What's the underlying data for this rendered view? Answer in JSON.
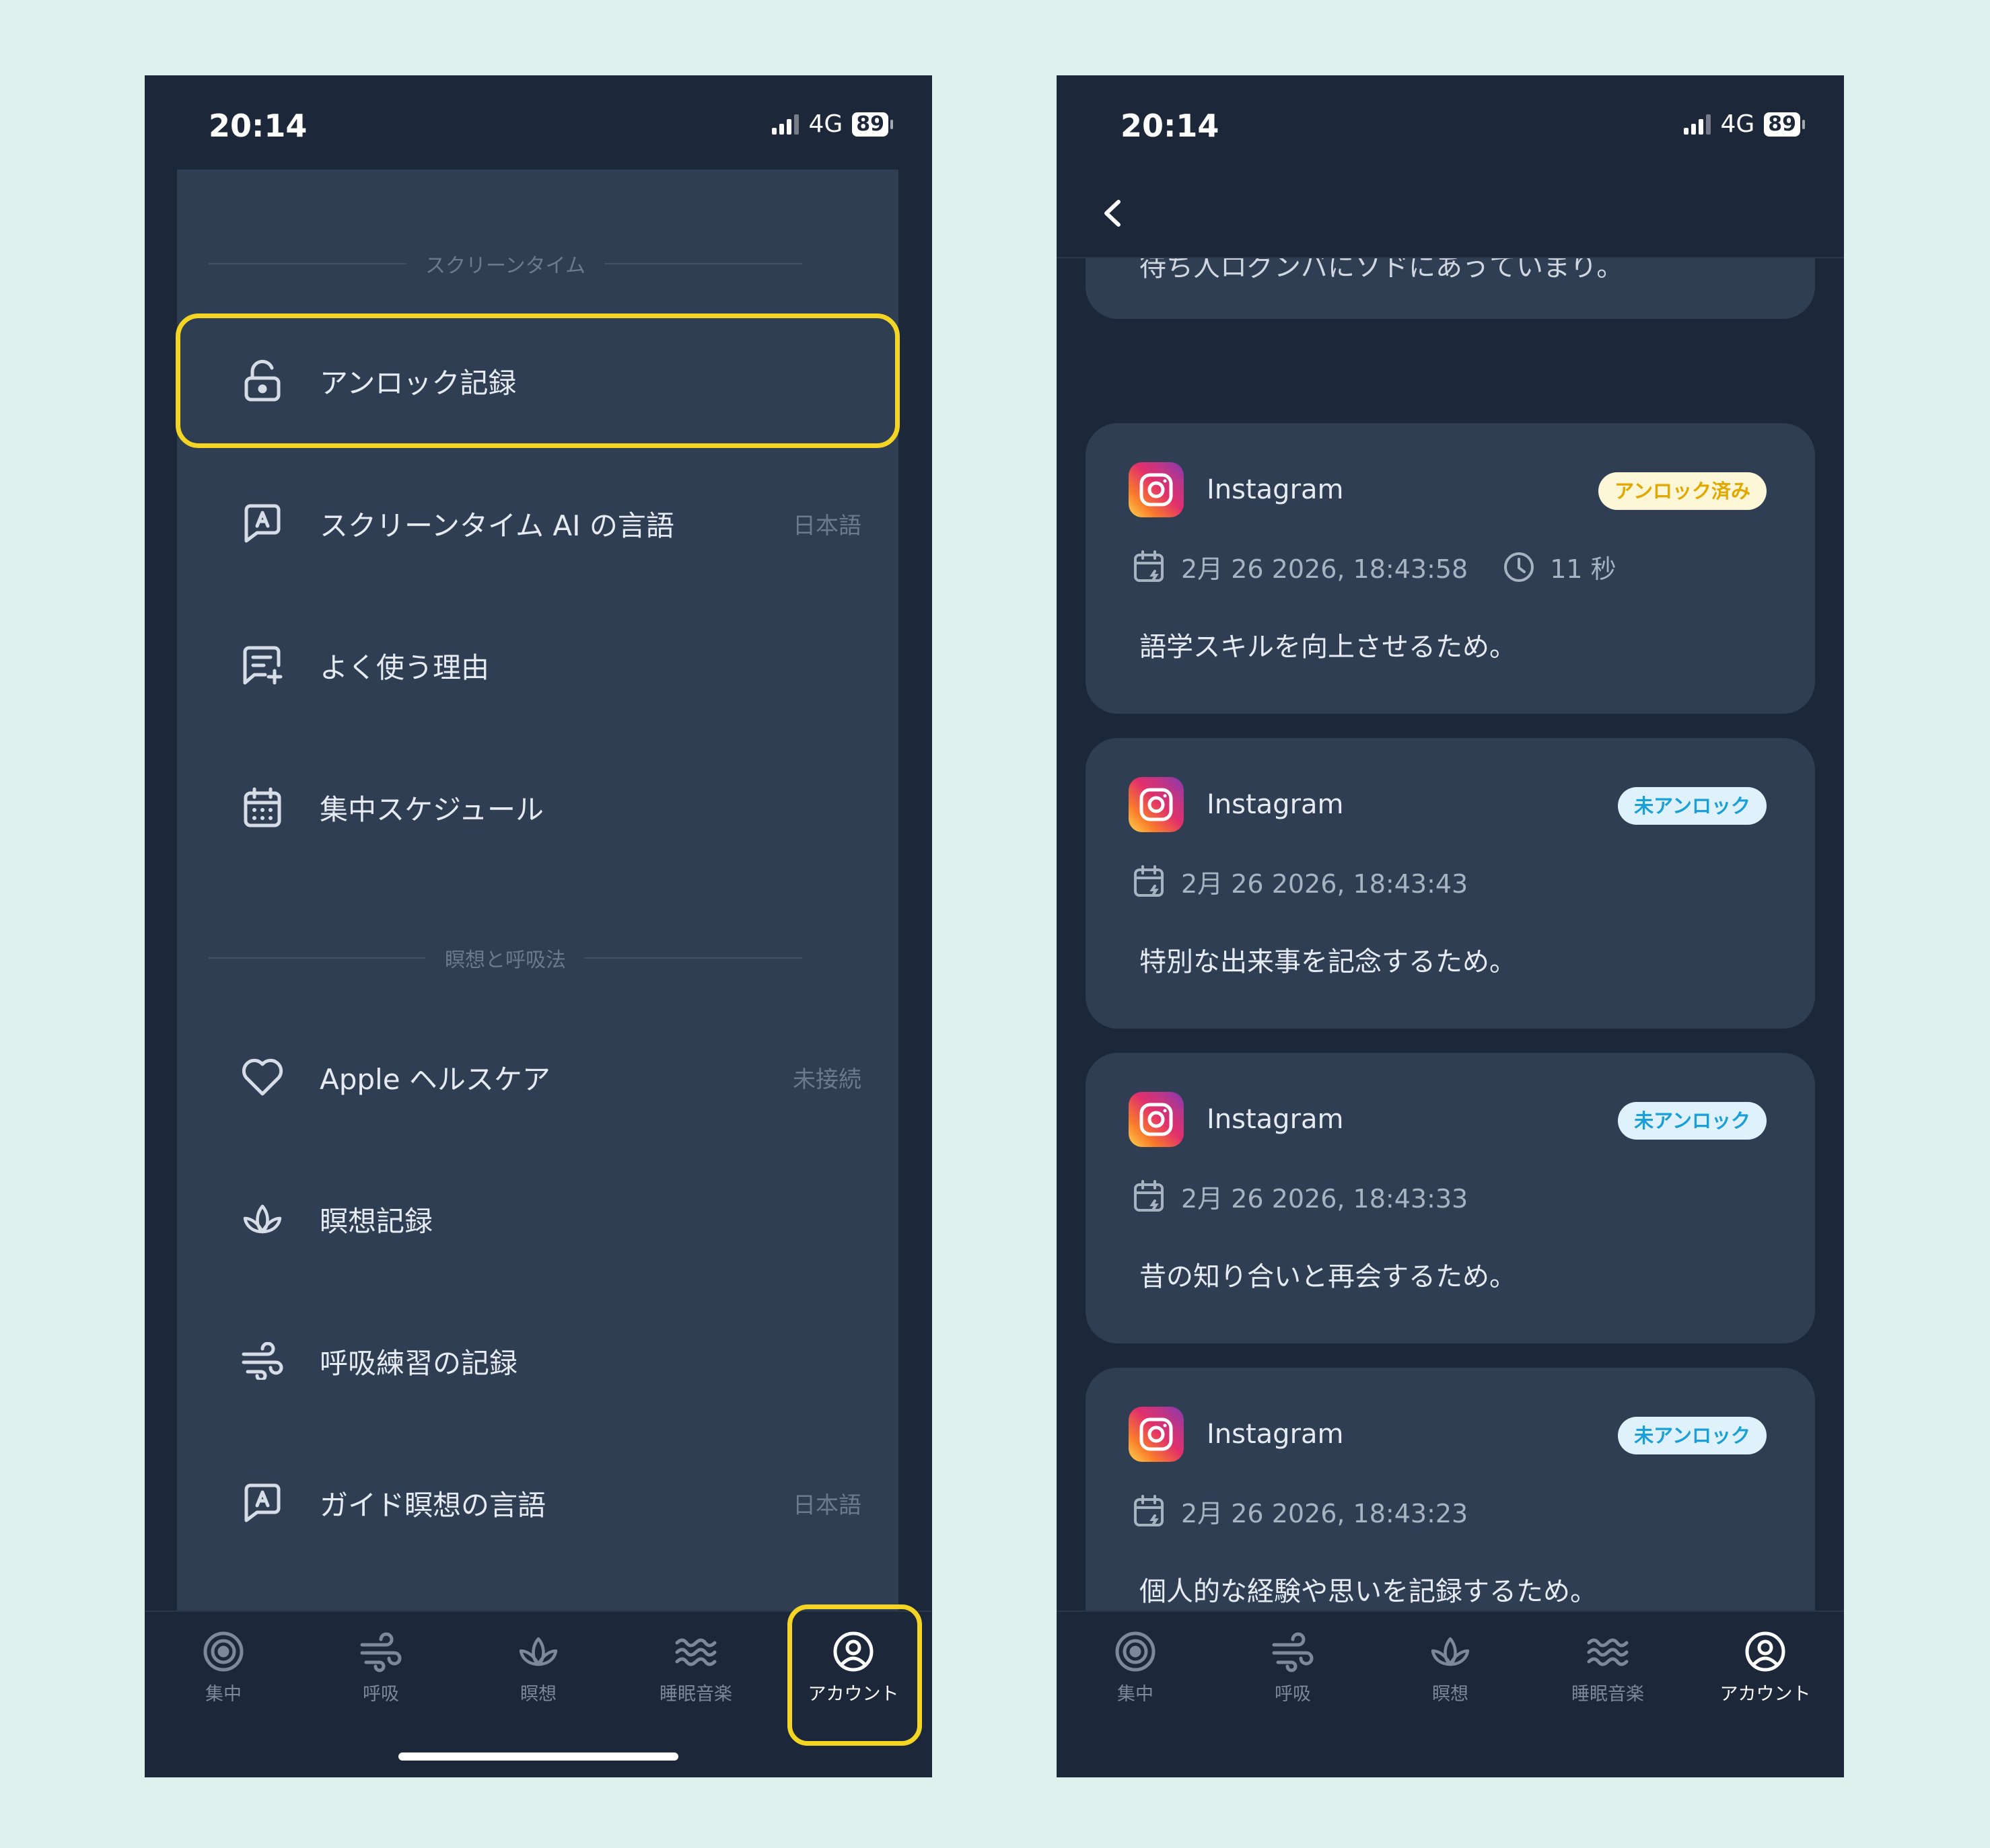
{
  "status": {
    "time": "20:14",
    "network": "4G",
    "battery": "89"
  },
  "left": {
    "sections": [
      {
        "title": "スクリーンタイム"
      },
      {
        "title": "瞑想と呼吸法"
      }
    ],
    "items": [
      {
        "label": "アンロック記録",
        "value": "",
        "icon": "unlock-icon"
      },
      {
        "label": "スクリーンタイム AI の言語",
        "value": "日本語",
        "icon": "language-chat-icon"
      },
      {
        "label": "よく使う理由",
        "value": "",
        "icon": "message-add-icon"
      },
      {
        "label": "集中スケジュール",
        "value": "",
        "icon": "calendar-icon"
      },
      {
        "label": "Apple ヘルスケア",
        "value": "未接続",
        "icon": "heart-icon"
      },
      {
        "label": "瞑想記録",
        "value": "",
        "icon": "lotus-icon"
      },
      {
        "label": "呼吸練習の記録",
        "value": "",
        "icon": "wind-icon"
      },
      {
        "label": "ガイド瞑想の言語",
        "value": "日本語",
        "icon": "language-chat-icon"
      }
    ]
  },
  "tabs": [
    {
      "label": "集中",
      "icon": "target-icon"
    },
    {
      "label": "呼吸",
      "icon": "wind-icon"
    },
    {
      "label": "瞑想",
      "icon": "lotus-icon"
    },
    {
      "label": "睡眠音楽",
      "icon": "waves-icon"
    },
    {
      "label": "アカウント",
      "icon": "user-circle-icon"
    }
  ],
  "right": {
    "partial_text": "待ち人ログンバにソドにあうていまり。",
    "records": [
      {
        "app": "Instagram",
        "status": "アンロック済み",
        "status_type": "unlocked",
        "date": "2月 26 2026, 18:43:58",
        "duration": "11 秒",
        "reason": "語学スキルを向上させるため。"
      },
      {
        "app": "Instagram",
        "status": "未アンロック",
        "status_type": "locked",
        "date": "2月 26 2026, 18:43:43",
        "duration": "",
        "reason": "特別な出来事を記念するため。"
      },
      {
        "app": "Instagram",
        "status": "未アンロック",
        "status_type": "locked",
        "date": "2月 26 2026, 18:43:33",
        "duration": "",
        "reason": "昔の知り合いと再会するため。"
      },
      {
        "app": "Instagram",
        "status": "未アンロック",
        "status_type": "locked",
        "date": "2月 26 2026, 18:43:23",
        "duration": "",
        "reason": "個人的な経験や思いを記録するため。"
      }
    ]
  },
  "colors": {
    "background": "#dff1ec",
    "phone": "#1c2739",
    "card": "#2f3e53",
    "highlight": "#f5d524"
  }
}
